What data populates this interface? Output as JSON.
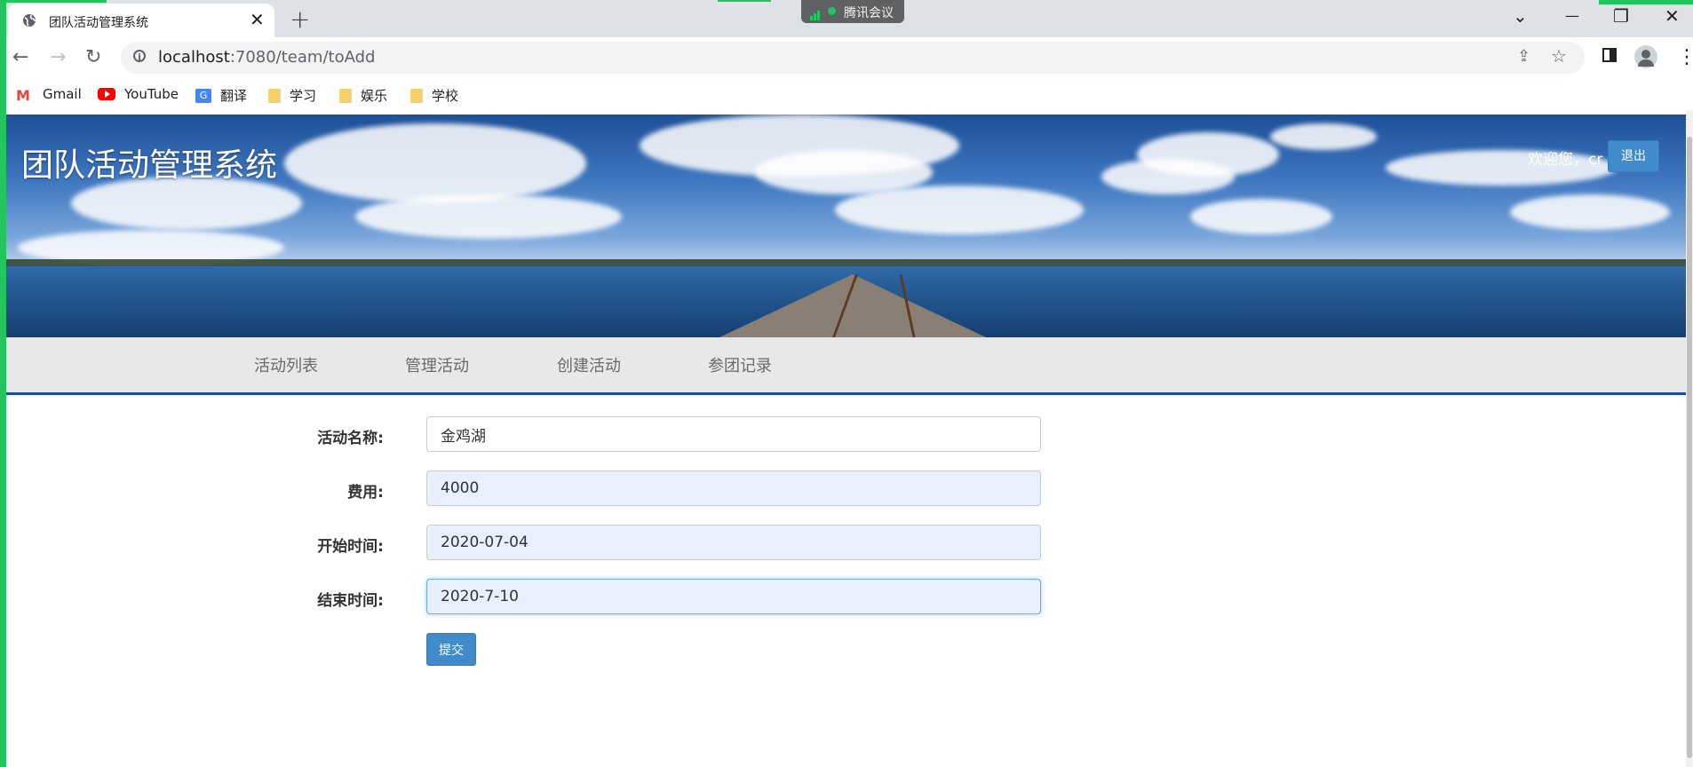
{
  "browser": {
    "tab_title": "团队活动管理系统",
    "tab_close": "✕",
    "new_tab": "+",
    "meeting_label": "腾讯会议",
    "url_host": "localhost",
    "url_rest": ":7080/team/toAdd",
    "bookmarks": [
      "Gmail",
      "YouTube",
      "翻译",
      "学习",
      "娱乐",
      "学校"
    ],
    "window_controls": {
      "dropdown": "⌄",
      "minimize": "—",
      "restore": "❐",
      "close": "✕"
    },
    "nav": {
      "back": "←",
      "forward": "→",
      "reload": "↻"
    }
  },
  "header": {
    "system_name": "团队活动管理系统",
    "welcome": "欢迎您，cr",
    "logout": "退出"
  },
  "nav_menu": [
    "活动列表",
    "管理活动",
    "创建活动",
    "参团记录"
  ],
  "form": {
    "fields": [
      {
        "label": "活动名称:",
        "value": "金鸡湖"
      },
      {
        "label": "费用:",
        "value": "4000"
      },
      {
        "label": "开始时间:",
        "value": "2020-07-04"
      },
      {
        "label": "结束时间:",
        "value": "2020-7-10"
      }
    ],
    "submit": "提交"
  },
  "colors": {
    "primary_button": "#428bca",
    "nav_underline": "#1a4c9c",
    "autofill_bg": "#e8f0fe",
    "accent_green": "#22c55e"
  }
}
